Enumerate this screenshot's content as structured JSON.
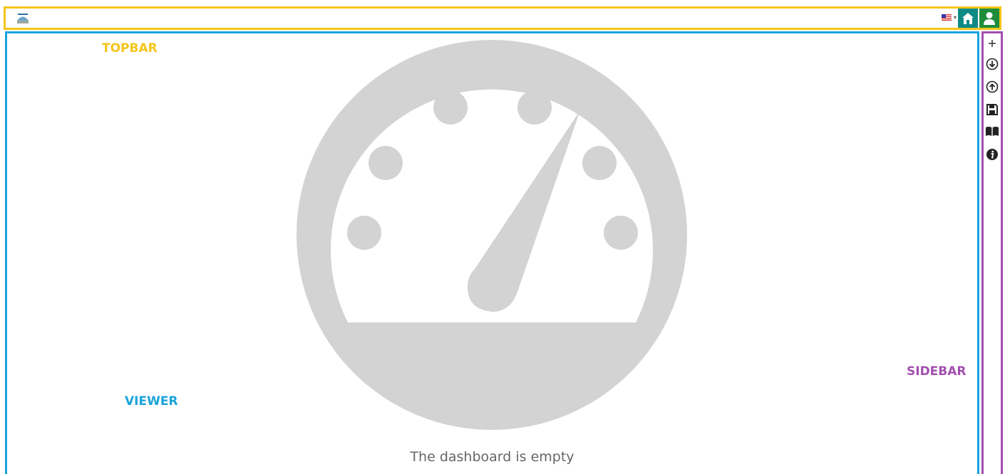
{
  "topbar": {
    "region_label": "TOPBAR",
    "language": "en-US flag",
    "home_icon": "home-icon",
    "user_icon": "user-icon",
    "home_color": "#0e8a86",
    "user_color": "#1e8c3a"
  },
  "viewer": {
    "region_label": "VIEWER",
    "empty_message": "The dashboard is empty",
    "placeholder_icon": "dashboard-gauge-icon",
    "placeholder_color": "#d3d3d3"
  },
  "sidebar": {
    "region_label": "SIDEBAR",
    "items": [
      {
        "icon": "plus-icon",
        "action": "add"
      },
      {
        "icon": "download-circle-icon",
        "action": "import"
      },
      {
        "icon": "upload-circle-icon",
        "action": "export"
      },
      {
        "icon": "save-icon",
        "action": "save"
      },
      {
        "icon": "book-icon",
        "action": "documentation"
      },
      {
        "icon": "info-icon",
        "action": "info"
      }
    ]
  },
  "colors": {
    "topbar_border": "#f5c518",
    "viewer_border": "#1aa3dc",
    "sidebar_border": "#a24fae"
  }
}
